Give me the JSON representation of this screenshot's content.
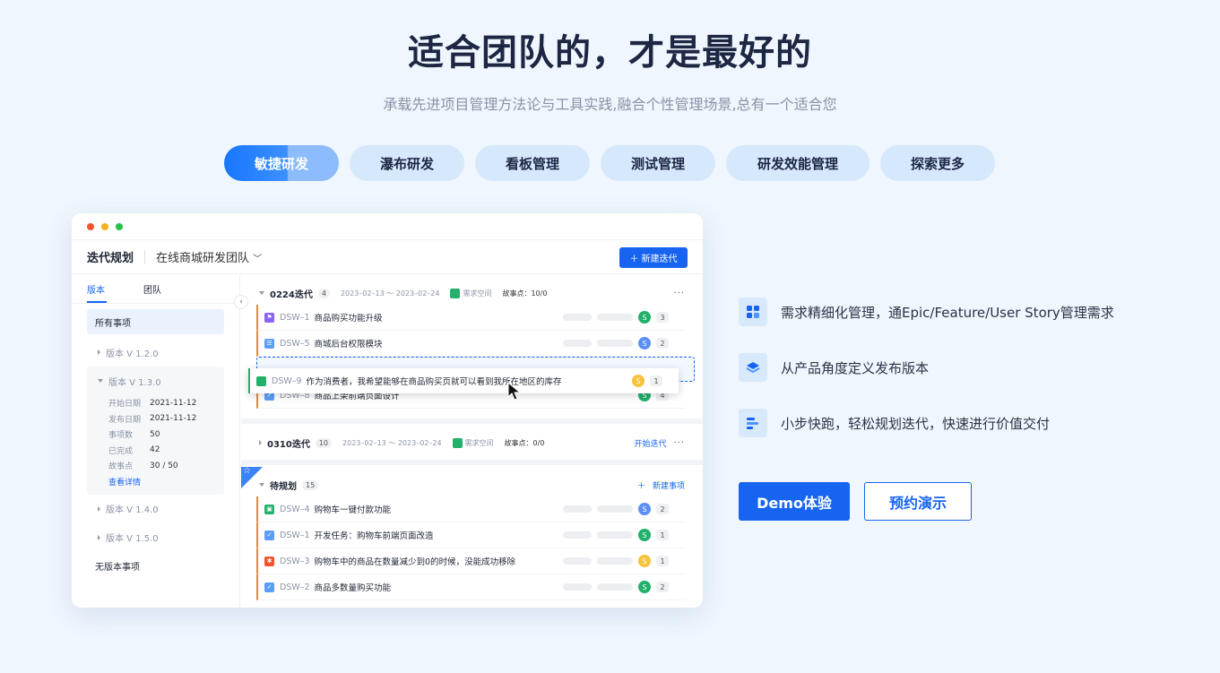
{
  "hero": {
    "title": "适合团队的，才是最好的",
    "subtitle": "承载先进项目管理方法论与工具实践,融合个性管理场景,总有一个适合您"
  },
  "tabs": [
    {
      "label": "敏捷研发",
      "active": true
    },
    {
      "label": "瀑布研发",
      "active": false
    },
    {
      "label": "看板管理",
      "active": false
    },
    {
      "label": "测试管理",
      "active": false
    },
    {
      "label": "研发效能管理",
      "active": false
    },
    {
      "label": "探索更多",
      "active": false
    }
  ],
  "app": {
    "title": "迭代规划",
    "team": "在线商城研发团队",
    "new_iteration": "新建迭代",
    "side_tabs": [
      "版本",
      "团队"
    ],
    "all_items": "所有事项",
    "versions": [
      "版本 V 1.2.0",
      "版本 V 1.3.0",
      "版本 V 1.4.0",
      "版本 V 1.5.0"
    ],
    "version_details": [
      {
        "k": "开始日期",
        "v": "2021-11-12"
      },
      {
        "k": "发布日期",
        "v": "2021-11-12"
      },
      {
        "k": "事项数",
        "v": "50"
      },
      {
        "k": "已完成",
        "v": "42"
      },
      {
        "k": "故事点",
        "v": "30 / 50"
      }
    ],
    "view_detail": "查看详情",
    "no_version": "无版本事项",
    "groups": [
      {
        "name": "0224迭代",
        "count": "4",
        "date": "2023–02–13 ～ 2023–02–24",
        "space": "需求空间",
        "points": "故事点：10/0",
        "action": ""
      },
      {
        "name": "0310迭代",
        "count": "10",
        "date": "2023–02–13 ～ 2023–02–24",
        "space": "需求空间",
        "points": "故事点：0/0",
        "action": "开始迭代"
      },
      {
        "name": "待规划",
        "count": "15",
        "date": "",
        "space": "",
        "points": "",
        "action": "新建事项"
      }
    ],
    "rows_a": [
      {
        "code": "DSW–1",
        "name": "商品购买功能升级",
        "avatar": "S",
        "num": "3"
      },
      {
        "code": "DSW–5",
        "name": "商城后台权限模块",
        "avatar": "S",
        "num": "2"
      },
      {
        "code": "DSW–8",
        "name": "商品上架前端页面设计",
        "avatar": "S",
        "num": "4"
      }
    ],
    "drag_row": {
      "code": "DSW–9",
      "name": "作为消费者，我希望能够在商品购买页就可以看到我所在地区的库存",
      "avatar": "S",
      "num": "1"
    },
    "rows_b": [
      {
        "code": "DSW–4",
        "name": "购物车一键付款功能",
        "avatar": "S",
        "num": "2"
      },
      {
        "code": "DSW–1",
        "name": "开发任务：购物车前端页面改造",
        "avatar": "S",
        "num": "1"
      },
      {
        "code": "DSW–3",
        "name": "购物车中的商品在数量减少到0的时候，没能成功移除",
        "avatar": "S",
        "num": "1"
      },
      {
        "code": "DSW–2",
        "name": "商品多数量购买功能",
        "avatar": "S",
        "num": "2"
      }
    ]
  },
  "features": [
    {
      "icon": "grid-icon",
      "text": "需求精细化管理，通Epic/Feature/User Story管理需求"
    },
    {
      "icon": "layers-icon",
      "text": "从产品角度定义发布版本"
    },
    {
      "icon": "bars-icon",
      "text": "小步快跑，轻松规划迭代，快速进行价值交付"
    }
  ],
  "cta": {
    "demo": "Demo体验",
    "book": "预约演示"
  },
  "colors": {
    "accent": "#1764f0",
    "page_bg": "#eff6fd",
    "tab_bg": "#d6e8fc"
  }
}
